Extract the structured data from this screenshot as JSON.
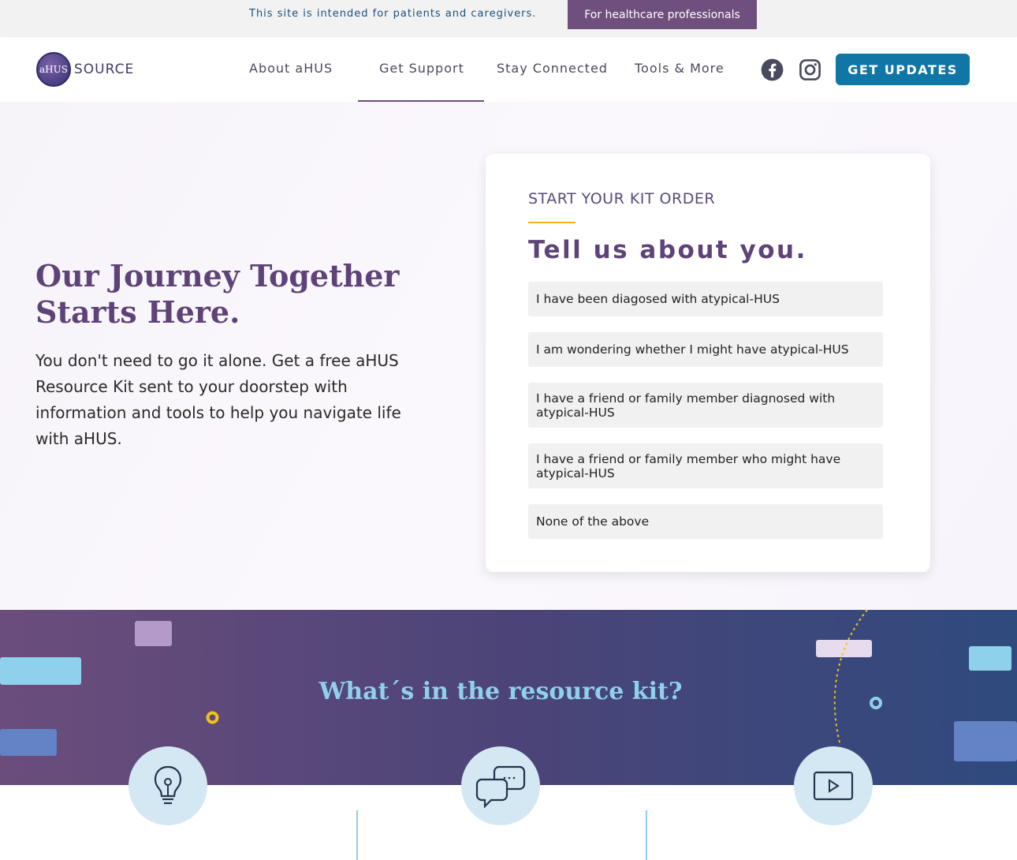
{
  "topbar": {
    "note": "This site is intended for patients and caregivers.",
    "hcp_button": "For healthcare professionals"
  },
  "header": {
    "logo_badge": "aHUS",
    "logo_text": "SOURCE",
    "nav": [
      "About aHUS",
      "Get Support",
      "Stay Connected",
      "Tools & More"
    ],
    "active_nav": "Get Support",
    "social_icons": [
      "facebook-icon",
      "instagram-icon"
    ],
    "updates_button": "GET UPDATES"
  },
  "hero": {
    "title": "Our Journey Together Starts Here.",
    "description": "You don't need to go it alone. Get a free aHUS Resource Kit sent to your doorstep with information and tools to help you navigate life with aHUS."
  },
  "kit_card": {
    "eyebrow": "START YOUR KIT ORDER",
    "heading": "Tell us about you.",
    "options": [
      "I have been diagosed with atypical-HUS",
      "I am wondering whether I might have atypical-HUS",
      "I have a friend or family member diagnosed with atypical-HUS",
      "I have a friend or family member who might have atypical-HUS",
      "None of the above"
    ]
  },
  "resource_band": {
    "title": "What´s in the resource kit?",
    "icons": [
      "lightbulb-icon",
      "chat-bubbles-icon",
      "video-play-icon"
    ]
  },
  "colors": {
    "brand_purple": "#6e4f7d",
    "accent_blue": "#0f76a6",
    "light_blue": "#8fd0ea",
    "gold": "#f0b323"
  }
}
